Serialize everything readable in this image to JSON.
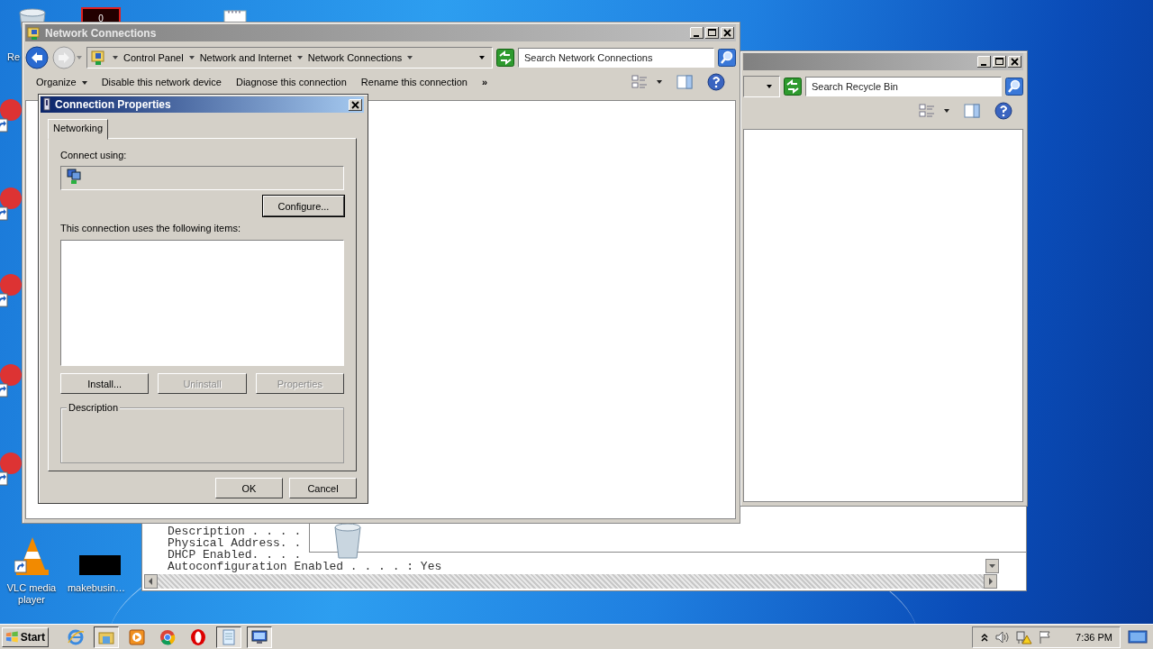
{
  "desktop": {
    "icons": [
      {
        "kind": "recycle-bin",
        "label": "Re"
      },
      {
        "kind": "counter",
        "text": "0"
      },
      {
        "kind": "notepad"
      },
      {
        "kind": "shortcut"
      },
      {
        "kind": "shortcut"
      },
      {
        "kind": "shortcut"
      },
      {
        "kind": "shortcut"
      },
      {
        "kind": "shortcut"
      },
      {
        "kind": "vlc",
        "label": "VLC media player"
      },
      {
        "kind": "blank",
        "label": "makebusin…"
      }
    ]
  },
  "console": {
    "lines": [
      "Description . . . .",
      "Physical Address. .",
      "DHCP Enabled. . . .",
      "Autoconfiguration Enabled . . . . : Yes"
    ]
  },
  "recycle_window": {
    "active": false,
    "search": {
      "placeholder": "Search Recycle Bin"
    }
  },
  "network_window": {
    "title": "Network Connections",
    "active": false,
    "breadcrumbs": [
      "Control Panel",
      "Network and Internet",
      "Network Connections"
    ],
    "search": {
      "placeholder": "Search Network Connections"
    },
    "toolbar": [
      {
        "kind": "menu",
        "label": "Organize"
      },
      {
        "kind": "command",
        "label": "Disable this network device"
      },
      {
        "kind": "command",
        "label": "Diagnose this connection"
      },
      {
        "kind": "command",
        "label": "Rename this connection"
      },
      {
        "kind": "overflow",
        "label": "»"
      }
    ]
  },
  "dialog": {
    "title": "Connection Properties",
    "active": true,
    "tabs": [
      {
        "label": "Networking",
        "selected": true
      }
    ],
    "connect_label": "Connect using:",
    "configure": {
      "label": "Configure...",
      "default": true
    },
    "items_label": "This connection uses the following items:",
    "item_buttons": [
      {
        "label": "Install...",
        "disabled": false
      },
      {
        "label": "Uninstall",
        "disabled": true
      },
      {
        "label": "Properties",
        "disabled": true
      }
    ],
    "description_label": "Description",
    "buttons": [
      {
        "label": "OK",
        "default": false
      },
      {
        "label": "Cancel",
        "default": false
      }
    ]
  },
  "taskbar": {
    "start": "Start",
    "items": [
      {
        "kind": "ie",
        "selected": false
      },
      {
        "kind": "explorer",
        "selected": true
      },
      {
        "kind": "media",
        "selected": false
      },
      {
        "kind": "chrome",
        "selected": false
      },
      {
        "kind": "opera",
        "selected": false
      },
      {
        "kind": "notepad",
        "selected": true
      },
      {
        "kind": "network",
        "selected": true
      }
    ],
    "tray": {
      "time": "7:36 PM"
    }
  }
}
